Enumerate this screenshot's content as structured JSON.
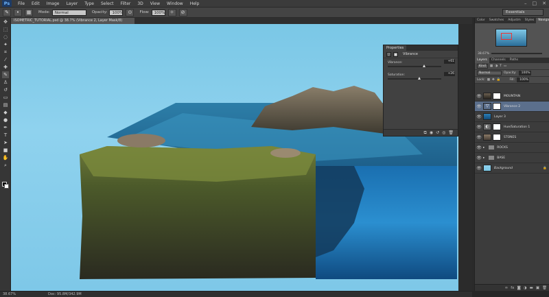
{
  "app": {
    "logo": "Ps"
  },
  "menu": [
    "File",
    "Edit",
    "Image",
    "Layer",
    "Type",
    "Select",
    "Filter",
    "3D",
    "View",
    "Window",
    "Help"
  ],
  "window_controls": [
    "–",
    "□",
    "✕"
  ],
  "options_bar": {
    "mode_label": "Mode:",
    "mode_value": "Normal",
    "opacity_label": "Opacity:",
    "opacity_value": "100%",
    "flow_label": "Flow:",
    "flow_value": "100%",
    "workspace": "Essentials"
  },
  "document": {
    "tab_title": "ISOMETRIC_TUTORIAL.psd @ 38.7% (Vibrance 2, Layer Mask/8)",
    "zoom": "38.67%",
    "doc_size": "Doc: 95.8M/342.9M"
  },
  "properties": {
    "tab": "Properties",
    "title": "Vibrance",
    "vibrance_label": "Vibrance:",
    "vibrance_value": "+61",
    "vibrance_level": 0.65,
    "saturation_label": "Saturation:",
    "saturation_value": "+26",
    "saturation_level": 0.56
  },
  "right_panels": {
    "top_tabs": [
      "Color",
      "Swatches",
      "Adjustm",
      "Styles",
      "Navigator"
    ],
    "navigator_zoom": "38.67%",
    "layer_tabs": [
      "Layers",
      "Channels",
      "Paths"
    ],
    "filter_kind": "Kind",
    "blend_mode": "Normal",
    "opacity_label": "Opacity:",
    "opacity_value": "100%",
    "lock_label": "Lock:",
    "fill_label": "Fill:",
    "fill_value": "100%"
  },
  "layers": [
    {
      "name": "MOUNTAIN",
      "type": "image",
      "selected": false
    },
    {
      "name": "Vibrance 2",
      "type": "adjust",
      "selected": true
    },
    {
      "name": "Layer 3",
      "type": "image",
      "selected": false
    },
    {
      "name": "Hue/Saturation 1",
      "type": "adjust",
      "selected": false
    },
    {
      "name": "STONES",
      "type": "image",
      "selected": false
    },
    {
      "name": "ROCKS",
      "type": "group",
      "selected": false
    },
    {
      "name": "BASE",
      "type": "group",
      "selected": false
    },
    {
      "name": "Background",
      "type": "bg",
      "selected": false
    }
  ],
  "colors": {
    "sky": "#7ac7e6",
    "selection": "#5b6f8c",
    "panel": "#3c3c3c"
  }
}
